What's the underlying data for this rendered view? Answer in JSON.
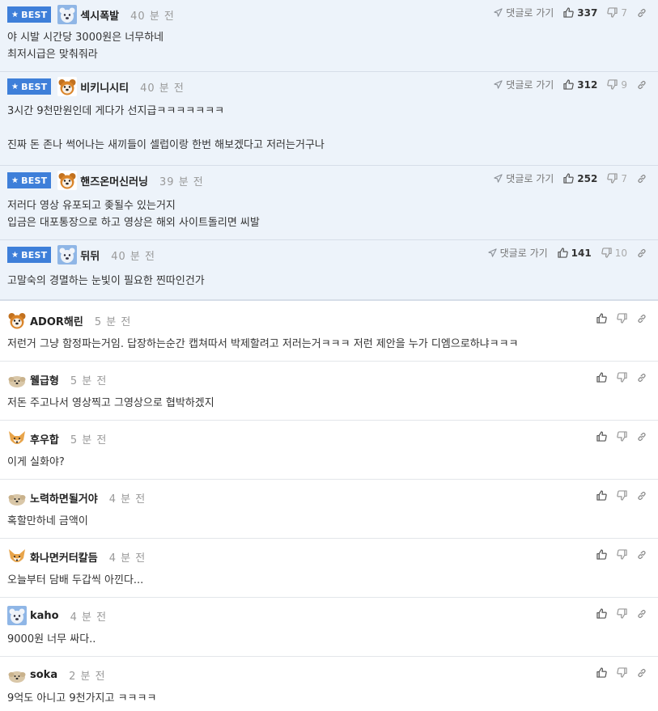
{
  "best_label": "BEST",
  "reply_link_label": "댓글로 가기",
  "best_comments": [
    {
      "nick": "섹시폭발",
      "time": "40 분 전",
      "text": "야 시발 시간당 3000원은 너무하네\n최저시급은 맞춰줘라",
      "up": "337",
      "down": "7",
      "avatar": "blue-bear"
    },
    {
      "nick": "비키니시티",
      "time": "40 분 전",
      "text": "3시간 9천만원인데 게다가 선지급ㅋㅋㅋㅋㅋㅋㅋ\n\n진짜 돈 존나 썩어나는 새끼들이 셀럽이랑 한번 해보겠다고 저러는거구나",
      "up": "312",
      "down": "9",
      "avatar": "brown-bear"
    },
    {
      "nick": "핸즈온머신러닝",
      "time": "39 분 전",
      "text": "저러다 영상 유포되고 좆될수 있는거지\n입금은 대포통장으로 하고 영상은 해외 사이트돌리면 씨발",
      "up": "252",
      "down": "7",
      "avatar": "brown-bear"
    },
    {
      "nick": "뒤뒤",
      "time": "40 분 전",
      "text": "고말숙의 경멸하는 눈빛이 필요한 찐따인건가",
      "up": "141",
      "down": "10",
      "avatar": "blue-bear"
    }
  ],
  "comments": [
    {
      "nick": "ADOR해린",
      "time": "5 분 전",
      "text": "저런거 그냥 함정파는거임. 답장하는순간 캡쳐따서 박제할려고 저러는거ㅋㅋㅋ 저런 제안을 누가 디엠으로하냐ㅋㅋㅋ",
      "avatar": "brown-bear"
    },
    {
      "nick": "웰급형",
      "time": "5 분 전",
      "text": "저돈 주고나서 영상찍고 그영상으로 협박하겠지",
      "avatar": "pup"
    },
    {
      "nick": "후우합",
      "time": "5 분 전",
      "text": "이게 실화야?",
      "avatar": "fox"
    },
    {
      "nick": "노력하면될거야",
      "time": "4 분 전",
      "text": "혹할만하네 금액이",
      "avatar": "pup"
    },
    {
      "nick": "화나면커터칼듬",
      "time": "4 분 전",
      "text": "오늘부터 담배 두갑씩 아낀다...",
      "avatar": "fox"
    },
    {
      "nick": "kaho",
      "time": "4 분 전",
      "text": "9000원 너무 싸다..",
      "avatar": "blue-bear"
    },
    {
      "nick": "soka",
      "time": "2 분 전",
      "text": "9억도 아니고 9천가지고 ㅋㅋㅋㅋ",
      "avatar": "pup"
    }
  ]
}
